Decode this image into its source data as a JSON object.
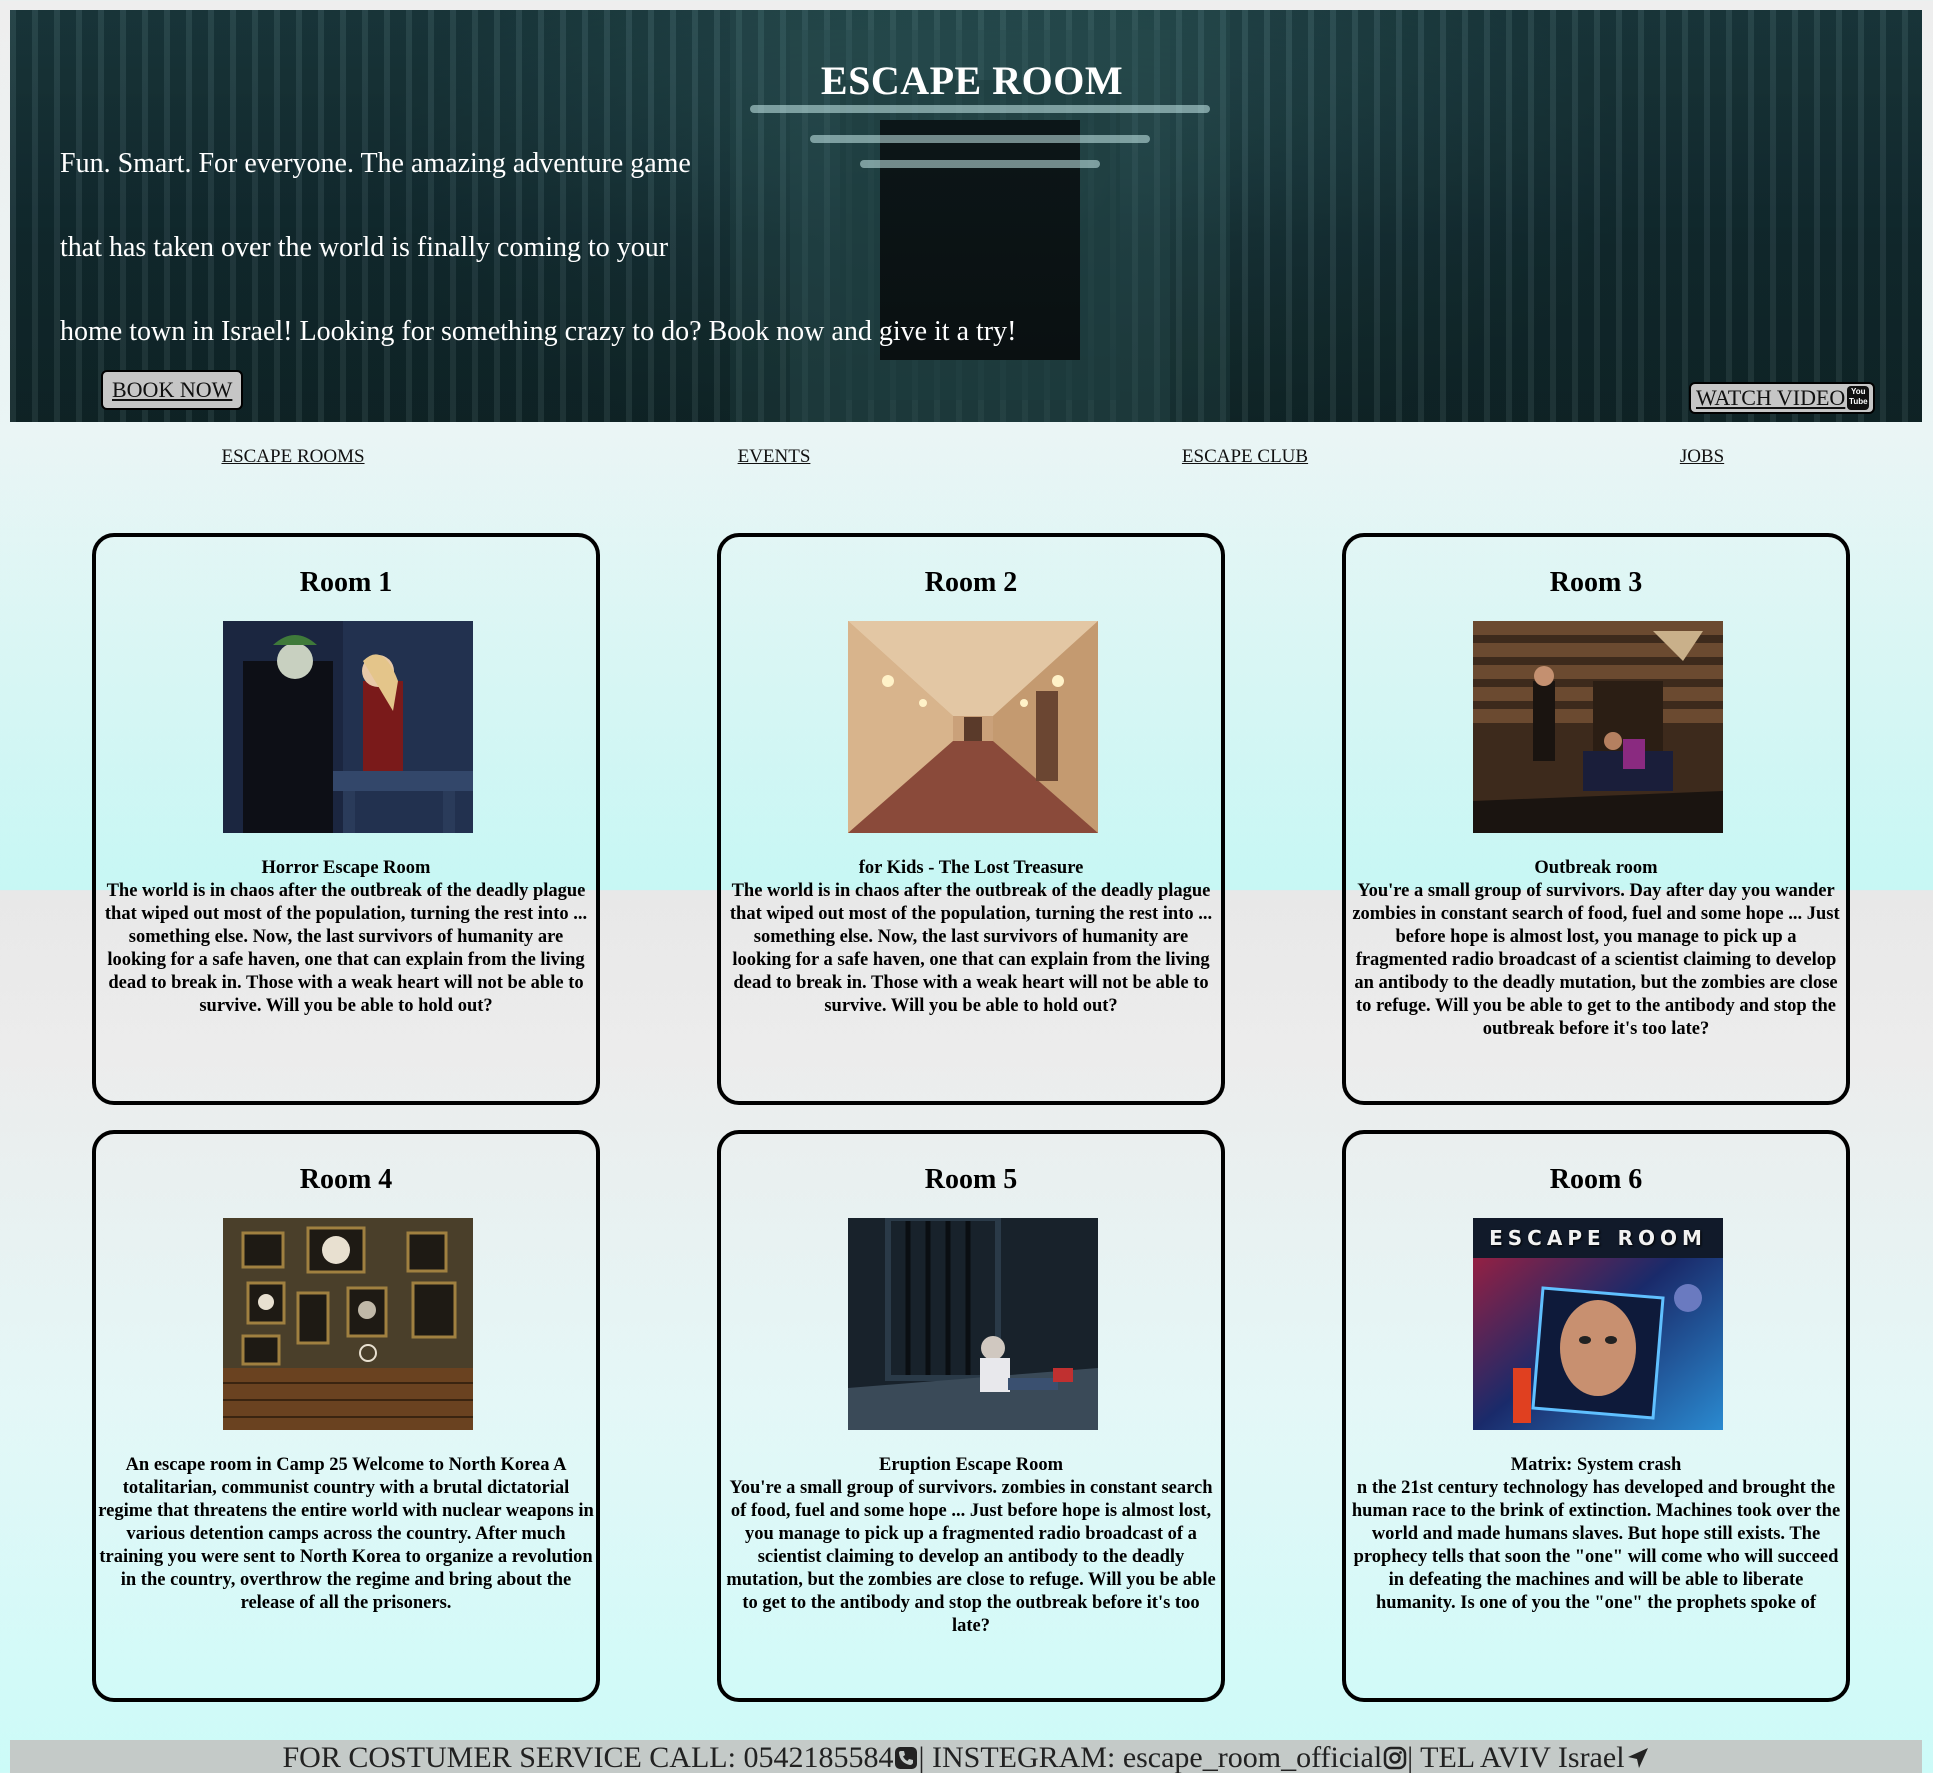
{
  "hero": {
    "title": "ESCAPE ROOM",
    "lines": [
      "Fun. Smart. For everyone. The amazing adventure game",
      "that has taken over the world is finally coming to your",
      "home town in Israel! Looking for something crazy to do? Book now and give it a try!"
    ],
    "book_label": "BOOK NOW",
    "video_label": "WATCH VIDEO",
    "video_icon": "youtube-icon",
    "video_icon_text_top": "You",
    "video_icon_text_bottom": "Tube"
  },
  "nav": {
    "items": [
      "ESCAPE ROOMS",
      "EVENTS",
      "ESCAPE CLUB",
      "JOBS"
    ]
  },
  "rooms": [
    {
      "title": "Room 1",
      "subtitle": "Horror Escape Room",
      "description": "The world is in chaos after the outbreak of the deadly plague that wiped out most of the population, turning the rest into ... something else. Now, the last survivors of humanity are looking for a safe haven, one that can explain from the living dead to break in. Those with a weak heart will not be able to survive. Will you be able to hold out?",
      "image": "horror-room-photo",
      "image_colors": [
        "#1b2a44",
        "#2e3f62",
        "#7a1a1a"
      ]
    },
    {
      "title": "Room 2",
      "subtitle": "for Kids - The Lost Treasure",
      "description": "The world is in chaos after the outbreak of the deadly plague that wiped out most of the population, turning the rest into ... something else. Now, the last survivors of humanity are looking for a safe haven, one that can explain from the living dead to break in. Those with a weak heart will not be able to survive. Will you be able to hold out?",
      "image": "hallway-photo",
      "image_colors": [
        "#d9b28a",
        "#b98a62",
        "#6e3e2c"
      ]
    },
    {
      "title": "Room 3",
      "subtitle": "Outbreak room",
      "description": "You're a small group of survivors. Day after day you wander zombies in constant search of food, fuel and some hope ... Just before hope is almost lost, you manage to pick up a fragmented radio broadcast of a scientist claiming to develop an antibody to the deadly mutation, but the zombies are close to refuge. Will you be able to get to the antibody and stop the outbreak before it's too late?",
      "image": "cabin-photo",
      "image_colors": [
        "#6b4a30",
        "#3d2a1c",
        "#1a1410"
      ]
    },
    {
      "title": "Room 4",
      "subtitle": "",
      "description": "An escape room in Camp 25 Welcome to North Korea A totalitarian, communist country with a brutal dictatorial regime that threatens the entire world with nuclear weapons in various detention camps across the country. After much training you were sent to North Korea to organize a revolution in the country, overthrow the regime and bring about the release of all the prisoners.",
      "image": "frames-wall-photo",
      "image_colors": [
        "#4a3f2a",
        "#2b241a",
        "#8a5a30"
      ]
    },
    {
      "title": "Room 5",
      "subtitle": "Eruption Escape Room",
      "description": "You're a small group of survivors. zombies in constant search of food, fuel and some hope ... Just before hope is almost lost, you manage to pick up a fragmented radio broadcast of a scientist claiming to develop an antibody to the deadly mutation, but the zombies are close to refuge. Will you be able to get to the antibody and stop the outbreak before it's too late?",
      "image": "prison-cell-photo",
      "image_colors": [
        "#1e2c38",
        "#3a5060",
        "#0e1418"
      ]
    },
    {
      "title": "Room 6",
      "subtitle": "Matrix: System crash",
      "description": "n the 21st century technology has developed and brought the human race to the brink of extinction. Machines took over the world and made humans slaves. But hope still exists. The prophecy tells that soon the \"one\" will come who will succeed in defeating the machines and will be able to liberate humanity. Is one of you the \"one\" the prophets spoke of",
      "image": "escape-room-poster",
      "image_label": "ESCAPE ROOM",
      "image_colors": [
        "#1a2a6a",
        "#b01e3a",
        "#2a8ad0"
      ]
    }
  ],
  "footer": {
    "service": "FOR COSTUMER SERVICE CALL: 0542185584",
    "instagram": "| INSTEGRAM: escape_room_official",
    "location": "| TEL AVIV Israel",
    "icons": [
      "phone-icon",
      "instagram-icon",
      "location-arrow-icon"
    ]
  }
}
